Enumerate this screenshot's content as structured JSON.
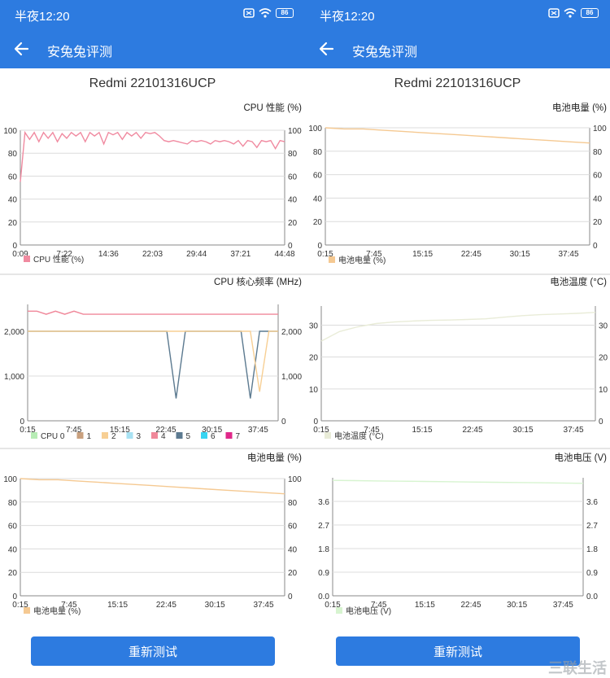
{
  "status": {
    "time": "半夜12:20",
    "battery": "86",
    "icons": [
      "screen-cast-icon",
      "wifi-icon",
      "battery-icon"
    ]
  },
  "app": {
    "title": "安兔兔评测",
    "back_icon": "back-arrow-icon"
  },
  "device_name": "Redmi 22101316UCP",
  "retest_label": "重新测试",
  "watermark": "三联生活",
  "colors": {
    "accent": "#2d7be0",
    "cpu_perf": "#f08aa0",
    "battery_level": "#f5c992",
    "temp": "#e9ecd8",
    "voltage": "#d7f4d0"
  },
  "left": {
    "charts": [
      {
        "title": "CPU 性能 (%)",
        "chart_data": {
          "type": "line",
          "title": "CPU 性能 (%)",
          "x_ticks": [
            "0:09",
            "7:22",
            "14:36",
            "22:03",
            "29:44",
            "37:21",
            "44:48"
          ],
          "y_ticks": [
            "0",
            "20",
            "40",
            "60",
            "80",
            "100"
          ],
          "ylim": [
            0,
            100
          ],
          "legend": [
            "CPU 性能 (%)"
          ],
          "series": [
            {
              "name": "CPU 性能 (%)",
              "values": [
                55,
                98,
                92,
                98,
                90,
                98,
                93,
                98,
                90,
                97,
                93,
                98,
                95,
                98,
                90,
                98,
                95,
                98,
                88,
                98,
                96,
                98,
                92,
                98,
                95,
                98,
                93,
                98,
                97,
                98,
                95,
                91,
                90,
                91,
                90,
                89,
                88,
                91,
                90,
                91,
                90,
                88,
                91,
                90,
                91,
                90,
                88,
                91,
                86,
                91,
                90,
                85,
                91,
                90,
                91,
                84,
                91,
                90
              ]
            }
          ]
        }
      },
      {
        "title": "CPU 核心频率 (MHz)",
        "chart_data": {
          "type": "line",
          "title": "CPU 核心频率 (MHz)",
          "x_ticks": [
            "0:15",
            "7:45",
            "15:15",
            "22:45",
            "30:15",
            "37:45"
          ],
          "y_ticks": [
            "0",
            "1,000",
            "2,000"
          ],
          "ylim": [
            0,
            2600
          ],
          "legend": [
            "CPU 0",
            "1",
            "2",
            "3",
            "4",
            "5",
            "6",
            "7"
          ],
          "legend_colors": [
            "#b7ecb5",
            "#c9a07e",
            "#f7cf94",
            "#a8e2f3",
            "#f0889a",
            "#5c7a90",
            "#38d5f2",
            "#e0288a"
          ],
          "series": [
            {
              "name": "4",
              "values": [
                2450,
                2450,
                2380,
                2450,
                2380,
                2450,
                2380,
                2380,
                2380,
                2380,
                2380,
                2380,
                2380,
                2380,
                2380,
                2380,
                2380,
                2380,
                2380,
                2380,
                2380,
                2380,
                2380,
                2380,
                2380,
                2380,
                2380,
                2380
              ]
            },
            {
              "name": "5",
              "values": [
                2000,
                2000,
                2000,
                2000,
                2000,
                2000,
                2000,
                2000,
                2000,
                2000,
                2000,
                2000,
                2000,
                2000,
                2000,
                2000,
                500,
                2000,
                2000,
                2000,
                2000,
                2000,
                2000,
                2000,
                500,
                2000,
                2000,
                2000
              ]
            },
            {
              "name": "2",
              "values": [
                2000,
                2000,
                2000,
                2000,
                2000,
                2000,
                2000,
                2000,
                2000,
                2000,
                2000,
                2000,
                2000,
                2000,
                2000,
                2000,
                2000,
                2000,
                2000,
                2000,
                2000,
                2000,
                2000,
                2000,
                2000,
                650,
                2000,
                2000
              ]
            }
          ]
        }
      },
      {
        "title": "电池电量 (%)",
        "chart_data": {
          "type": "line",
          "title": "电池电量 (%)",
          "x_ticks": [
            "0:15",
            "7:45",
            "15:15",
            "22:45",
            "30:15",
            "37:45"
          ],
          "y_ticks": [
            "0",
            "20",
            "40",
            "60",
            "80",
            "100"
          ],
          "ylim": [
            0,
            100
          ],
          "legend": [
            "电池电量 (%)"
          ],
          "series": [
            {
              "name": "电池电量 (%)",
              "values": [
                100,
                99,
                99,
                98,
                97,
                96,
                95,
                94,
                93,
                92,
                91,
                90,
                89,
                88,
                87
              ]
            }
          ]
        }
      }
    ]
  },
  "right": {
    "charts": [
      {
        "title": "电池电量 (%)",
        "chart_data": {
          "type": "line",
          "title": "电池电量 (%)",
          "x_ticks": [
            "0:15",
            "7:45",
            "15:15",
            "22:45",
            "30:15",
            "37:45"
          ],
          "y_ticks": [
            "0",
            "20",
            "40",
            "60",
            "80",
            "100"
          ],
          "ylim": [
            0,
            100
          ],
          "legend": [
            "电池电量 (%)"
          ],
          "series": [
            {
              "name": "电池电量 (%)",
              "values": [
                100,
                99,
                99,
                98,
                97,
                96,
                95,
                94,
                93,
                92,
                91,
                90,
                89,
                88,
                87
              ]
            }
          ]
        }
      },
      {
        "title": "电池温度 (°C)",
        "chart_data": {
          "type": "line",
          "title": "电池温度 (°C)",
          "x_ticks": [
            "0:15",
            "7:45",
            "15:15",
            "22:45",
            "30:15",
            "37:45"
          ],
          "y_ticks": [
            "0",
            "10",
            "20",
            "30"
          ],
          "ylim": [
            0,
            36
          ],
          "legend": [
            "电池温度 (°C)"
          ],
          "series": [
            {
              "name": "电池温度 (°C)",
              "values": [
                25,
                28,
                29.5,
                30.5,
                31,
                31.3,
                31.5,
                31.6,
                31.8,
                32,
                32.5,
                33,
                33.3,
                33.5,
                33.7,
                34
              ]
            }
          ]
        }
      },
      {
        "title": "电池电压 (V)",
        "chart_data": {
          "type": "line",
          "title": "电池电压 (V)",
          "x_ticks": [
            "0:15",
            "7:45",
            "15:15",
            "22:45",
            "30:15",
            "37:45"
          ],
          "y_ticks": [
            "0.0",
            "0.9",
            "1.8",
            "2.7",
            "3.6"
          ],
          "ylim": [
            0,
            4.5
          ],
          "legend": [
            "电池电压 (V)"
          ],
          "series": [
            {
              "name": "电池电压 (V)",
              "values": [
                4.4,
                4.39,
                4.38,
                4.37,
                4.36,
                4.35,
                4.34,
                4.33,
                4.32,
                4.31,
                4.3,
                4.29
              ]
            }
          ]
        }
      }
    ]
  }
}
